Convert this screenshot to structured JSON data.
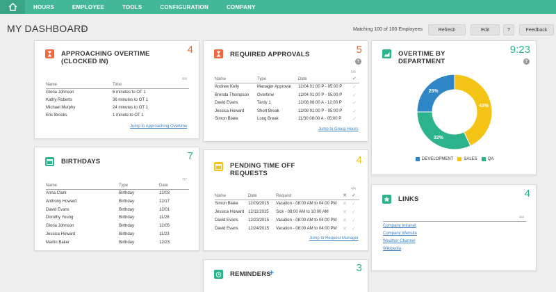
{
  "nav": {
    "items": [
      "HOURS",
      "EMPLOYEE",
      "TOOLS",
      "CONFIGURATION",
      "COMPANY"
    ]
  },
  "header": {
    "title": "MY DASHBOARD",
    "matching": "Matching 100 of 100 Employees",
    "refresh": "Refresh",
    "edit": "Edit",
    "help": "?",
    "feedback": "Feedback"
  },
  "overtime_card": {
    "title_1": "APPROACHING OVERTIME",
    "title_2": "(CLOCKED IN)",
    "count": "4",
    "frac": "4/4",
    "col_name": "Name",
    "col_time": "Time",
    "rows": [
      [
        "Gloria Johnson",
        "6 minutes to OT 1"
      ],
      [
        "Kathy Roberts",
        "36 minutes to OT 1"
      ],
      [
        "Michael Murphy",
        "24 minutes to OT 1"
      ],
      [
        "Eric Brooks",
        "1 minute to OT 1"
      ]
    ],
    "link": "Jump to Approaching Overtime"
  },
  "approvals_card": {
    "title": "REQUIRED APPROVALS",
    "count": "5",
    "frac": "5/5",
    "col_name": "Name",
    "col_type": "Type",
    "col_date": "Date",
    "rows": [
      [
        "Andrew Kelly",
        "Manager Approval",
        "12/04 01:00 P - 05:00 P"
      ],
      [
        "Brenda Thompson",
        "Overtime",
        "12/04 01:00 P - 05:00 P"
      ],
      [
        "David Evans",
        "Tardy 1",
        "12/08 08:00 A - 12:00 P"
      ],
      [
        "Jessica Howard",
        "Short Break",
        "12/08 01:00 P - 05:00 P"
      ],
      [
        "Simon Blake",
        "Long Break",
        "11/30 08:00 A - 05:00 P"
      ]
    ],
    "link": "Jump to Group Hours"
  },
  "dept_card": {
    "title_1": "OVERTIME BY",
    "title_2": "DEPARTMENT",
    "count": "9:23",
    "legend": [
      "DEVELOPMENT",
      "SALES",
      "QA"
    ]
  },
  "chart_data": {
    "type": "pie",
    "categories": [
      "DEVELOPMENT",
      "SALES",
      "QA"
    ],
    "values": [
      25,
      43,
      32
    ],
    "labels": [
      "25%",
      "43%",
      "32%"
    ],
    "colors": [
      "#2f86c7",
      "#f3c316",
      "#2db38b"
    ],
    "legend_position": "bottom"
  },
  "birthdays_card": {
    "title": "BIRTHDAYS",
    "count": "7",
    "frac": "7/7",
    "col_name": "Name",
    "col_type": "Type",
    "col_date": "Date",
    "rows": [
      [
        "Anna Clark",
        "Birthday",
        "12/03"
      ],
      [
        "Anthony Howard",
        "Birthday",
        "12/17"
      ],
      [
        "David Evans",
        "Birthday",
        "12/01"
      ],
      [
        "Dorothy Young",
        "Birthday",
        "11/28"
      ],
      [
        "Gloria Johnson",
        "Birthday",
        "12/05"
      ],
      [
        "Jessica Howard",
        "Birthday",
        "11/23"
      ],
      [
        "Martin Baker",
        "Birthday",
        "12/23"
      ]
    ]
  },
  "timeoff_card": {
    "title_1": "PENDING TIME OFF",
    "title_2": "REQUESTS",
    "count": "4",
    "frac": "4/4",
    "col_name": "Name",
    "col_date": "Date",
    "col_request": "Request",
    "rows": [
      [
        "Simon Blake",
        "12/09/2015",
        "Vacation - 08:00 AM to 04:00 PM"
      ],
      [
        "Jessica Howard",
        "12/11/2015",
        "Sick - 08:00 AM to 10:00 AM"
      ],
      [
        "David Evans",
        "12/23/2015",
        "Vacation - 08:00 AM to 04:00 PM"
      ],
      [
        "David Evans",
        "12/24/2015",
        "Vacation - 08:00 AM to 04:00 PM"
      ]
    ],
    "link": "Jump to Request Manager"
  },
  "links_card": {
    "title": "LINKS",
    "count": "4",
    "frac": "4/4",
    "items": [
      "Company Intranet",
      "Company Website",
      "Weather Channel",
      "Wikipedia"
    ]
  },
  "reminders_card": {
    "title": "REMINDERS",
    "plus": "+",
    "count": "3"
  },
  "colors": {
    "nav": "#43b896",
    "orange": "#ee6a3e",
    "green": "#2db38b",
    "yellow": "#f3c316",
    "blue_link": "#3a7fc4"
  }
}
